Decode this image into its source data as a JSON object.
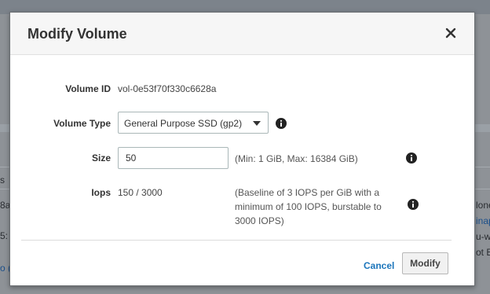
{
  "background": {
    "left_fragments": [
      "s",
      "8a",
      "5:",
      "o (i"
    ],
    "right_fragments": [
      "lone",
      "inap",
      "u-we",
      "ot E"
    ]
  },
  "modal": {
    "title": "Modify Volume",
    "close_icon": "close-icon",
    "fields": {
      "volume_id": {
        "label": "Volume ID",
        "value": "vol-0e53f70f330c6628a"
      },
      "volume_type": {
        "label": "Volume Type",
        "selected": "General Purpose SSD (gp2)",
        "icon": "chevron-down-icon",
        "info_icon": "info-icon"
      },
      "size": {
        "label": "Size",
        "value": "50",
        "hint": "(Min: 1 GiB, Max: 16384 GiB)",
        "info_icon": "info-icon"
      },
      "iops": {
        "label": "Iops",
        "value": "150 / 3000",
        "hint_lines": [
          "(Baseline of 3 IOPS per GiB with a",
          "minimum of 100 IOPS, burstable to",
          "3000 IOPS)"
        ],
        "info_icon": "info-icon"
      }
    },
    "buttons": {
      "cancel": "Cancel",
      "modify": "Modify"
    }
  },
  "colors": {
    "accent_link": "#1b75bb",
    "title": "#333333"
  }
}
